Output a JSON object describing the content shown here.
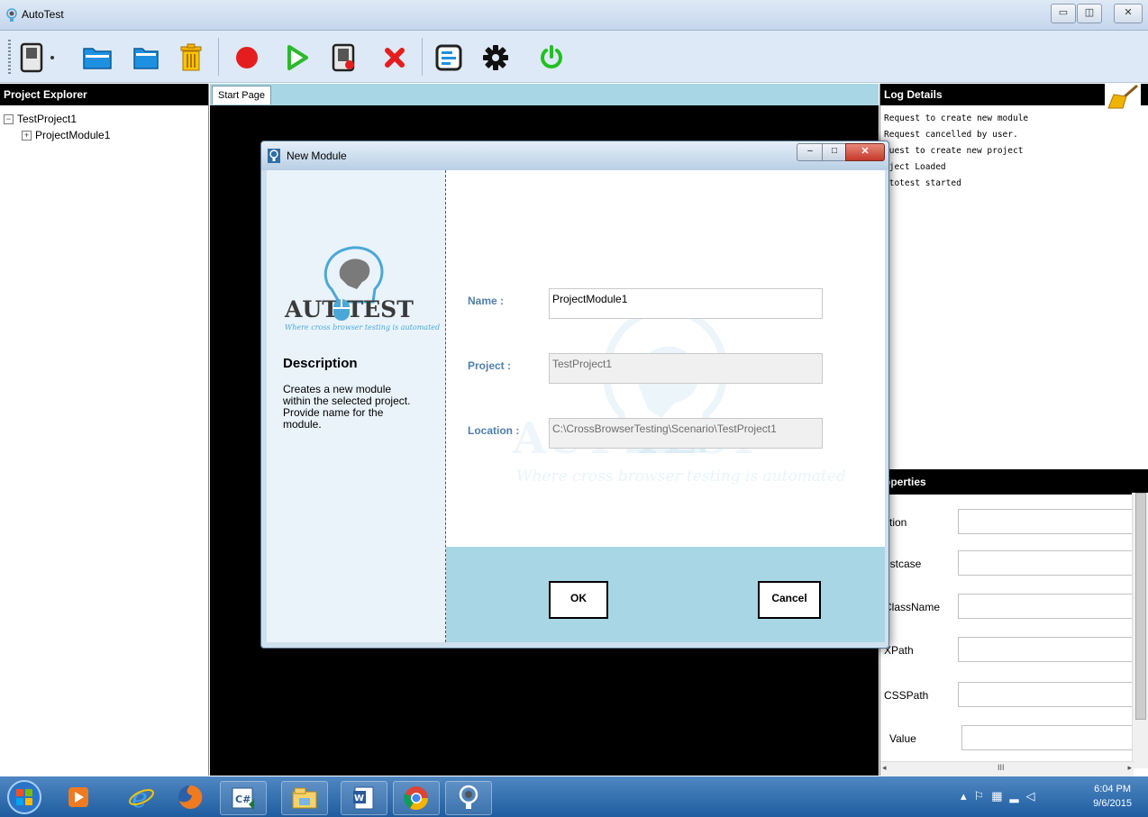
{
  "app": {
    "title": "AutoTest"
  },
  "toolbar": {
    "icons": [
      "new-project-icon",
      "dropdown-arrow-icon",
      "open-folder-icon",
      "folder-icon",
      "delete-icon",
      "record-icon",
      "run-icon",
      "stop-record-icon",
      "close-icon",
      "report-icon",
      "settings-icon",
      "power-icon"
    ]
  },
  "explorer": {
    "header": "Project Explorer",
    "tree": [
      {
        "label": "TestProject1",
        "expander": "−"
      },
      {
        "label": "ProjectModule1",
        "expander": "+"
      }
    ]
  },
  "tabs": {
    "start_page": "Start Page"
  },
  "log": {
    "header": "Log Details",
    "lines": [
      "Request to create new module",
      "Request cancelled by user.",
      "quest to create new project",
      "oject Loaded",
      "utotest started"
    ]
  },
  "properties": {
    "header": "operties",
    "rows": [
      {
        "label": "ction",
        "value": ""
      },
      {
        "label": "estcase",
        "value": ""
      },
      {
        "label": "ClassName",
        "value": ""
      },
      {
        "label": "XPath",
        "value": ""
      },
      {
        "label": "CSSPath",
        "value": ""
      },
      {
        "label": "Value",
        "value": ""
      }
    ],
    "hscroll_mark": "III"
  },
  "dialog": {
    "title": "New Module",
    "logo_text": "AUT  TEST",
    "logo_tagline": "Where cross browser testing is automated",
    "description_heading": "Description",
    "description_text": "Creates a new module within the selected project. Provide name for the module.",
    "fields": {
      "name_label": "Name :",
      "name_value": "ProjectModule1",
      "project_label": "Project :",
      "project_value": "TestProject1",
      "location_label": "Location :",
      "location_value": "C:\\CrossBrowserTesting\\Scenario\\TestProject1"
    },
    "ok_label": "OK",
    "cancel_label": "Cancel"
  },
  "taskbar": {
    "time": "6:04 PM",
    "date": "9/6/2015"
  },
  "colors": {
    "accent": "#a9d6e5",
    "label_blue": "#4f7faa",
    "record_red": "#e41e1e",
    "run_green": "#2eb82e"
  }
}
